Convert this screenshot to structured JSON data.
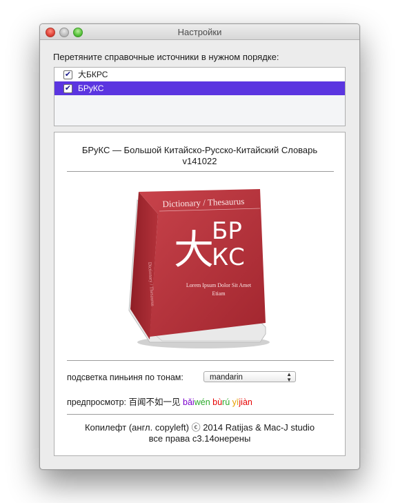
{
  "window": {
    "title": "Настройки"
  },
  "instruction": "Перетяните справочные источники в нужном порядке:",
  "sources": [
    {
      "label": "大БКРС",
      "checked": true,
      "selected": false
    },
    {
      "label": "БРуКС",
      "checked": true,
      "selected": true
    }
  ],
  "dictionary": {
    "title_line1": "БРуКС — Большой Китайско-Русско-Китайский Словарь",
    "title_line2": "v141022",
    "book": {
      "header": "Dictionary / Thesaurus",
      "big_char": "大",
      "letters_top": "БР",
      "letters_bottom": "КС",
      "caption_line1": "Lorem Ipsum Dolor Sit Amet",
      "caption_line2": "Etiam",
      "spine": "Dictionary / Thesaurus"
    }
  },
  "tone_highlight": {
    "label": "подсветка пиньиня по тонам:",
    "selected": "mandarin"
  },
  "preview": {
    "label": "предпросмотр:",
    "hanzi": "百闻不如一见",
    "pinyin": [
      {
        "text": "bǎi",
        "color": "#7a00cc"
      },
      {
        "text": "wén",
        "color": "#2aa82a"
      },
      {
        "text": " ",
        "color": "#000000"
      },
      {
        "text": "bù",
        "color": "#e60000"
      },
      {
        "text": "rú",
        "color": "#2aa82a"
      },
      {
        "text": " ",
        "color": "#000000"
      },
      {
        "text": "yī",
        "color": "#e6a100"
      },
      {
        "text": "jiàn",
        "color": "#e60000"
      }
    ]
  },
  "footer": {
    "line1": "Копилефт (англ. copyleft) ⓒ 2014 Ratijas & Mac-J studio",
    "line2": "все права с3.14онерены"
  },
  "colors": {
    "selection": "#5b35e0",
    "book_red": "#b8313a"
  }
}
